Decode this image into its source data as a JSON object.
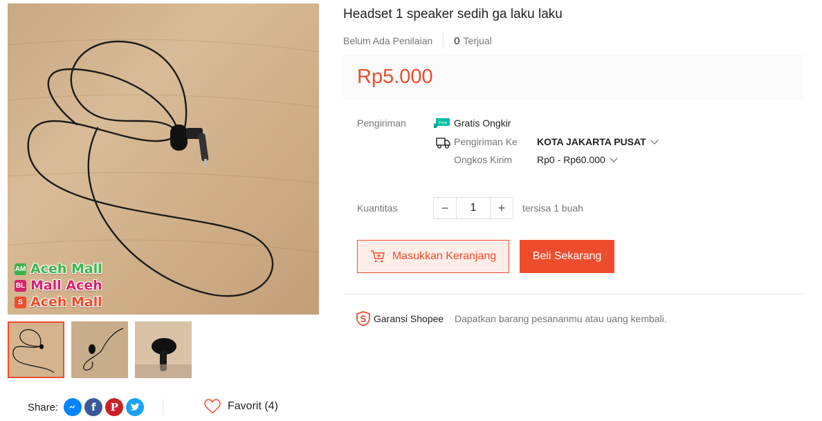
{
  "product": {
    "title": "Headset 1 speaker sedih ga laku laku",
    "rating_text": "Belum Ada Penilaian",
    "sold_count": "0",
    "sold_label": "Terjual",
    "price": "Rp5.000"
  },
  "gallery": {
    "watermark": [
      {
        "icon": "AM",
        "text": "Aceh Mall",
        "color": "#3bb54a",
        "icon_color": "#3bb54a"
      },
      {
        "icon": "BL",
        "text": "Mall Aceh",
        "color": "#d6226b",
        "icon_color": "#d6226b"
      },
      {
        "icon": "S",
        "text": "Aceh Mall",
        "color": "#ee4d2d",
        "icon_color": "#ee4d2d"
      }
    ]
  },
  "shipping": {
    "label": "Pengiriman",
    "free_badge": "Free",
    "free_text": "Gratis Ongkir",
    "to_label": "Pengiriman Ke",
    "destination": "KOTA JAKARTA PUSAT",
    "cost_label": "Ongkos Kirim",
    "cost_range": "Rp0 - Rp60.000"
  },
  "quantity": {
    "label": "Kuantitas",
    "minus": "−",
    "value": "1",
    "plus": "+",
    "stock_text": "tersisa 1 buah"
  },
  "actions": {
    "add_to_cart": "Masukkan Keranjang",
    "buy_now": "Beli Sekarang"
  },
  "guarantee": {
    "title": "Garansi Shopee",
    "text": "Dapatkan barang pesananmu atau uang kembali."
  },
  "share": {
    "label": "Share:",
    "networks": [
      "messenger-icon",
      "facebook-icon",
      "pinterest-icon",
      "twitter-icon"
    ]
  },
  "favorite": {
    "label": "Favorit (4)"
  },
  "colors": {
    "accent": "#ee4d2d",
    "free_badge": "#00bfa5",
    "messenger": "#0084ff",
    "facebook": "#3b5998",
    "pinterest": "#cb2027",
    "twitter": "#1da1f2"
  }
}
